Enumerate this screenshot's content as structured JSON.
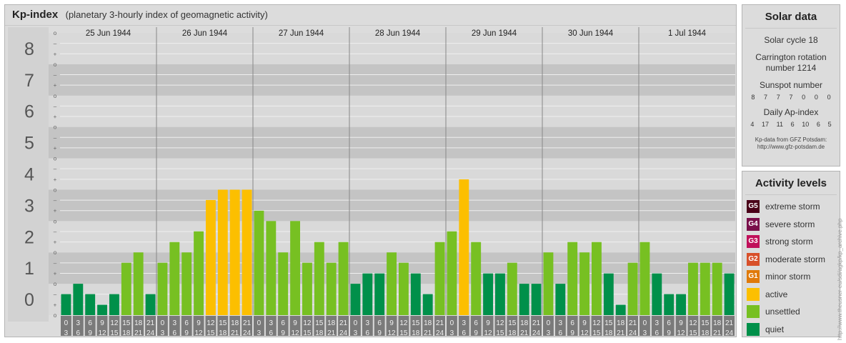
{
  "title": "Kp-index",
  "subtitle": "(planetary 3-hourly index of geomagnetic activity)",
  "chart_data": {
    "type": "bar",
    "ylim": [
      0,
      9
    ],
    "y_ticks": [
      "0",
      "1",
      "2",
      "3",
      "4",
      "5",
      "6",
      "7",
      "8",
      "9"
    ],
    "minor_tick_labels": [
      "o",
      "+",
      "–"
    ],
    "days": [
      "25 Jun 1944",
      "26 Jun 1944",
      "27 Jun 1944",
      "28 Jun 1944",
      "29 Jun 1944",
      "30 Jun 1944",
      "1 Jul 1944"
    ],
    "interval_top": [
      "0",
      "3",
      "6",
      "9",
      "12",
      "15",
      "18",
      "21"
    ],
    "interval_bottom": [
      "3",
      "6",
      "9",
      "12",
      "15",
      "18",
      "21",
      "24"
    ],
    "values": [
      [
        0.67,
        1.0,
        0.67,
        0.33,
        0.67,
        1.67,
        2.0,
        0.67
      ],
      [
        1.67,
        2.33,
        2.0,
        2.67,
        3.67,
        4.0,
        4.0,
        4.0
      ],
      [
        3.33,
        3.0,
        2.0,
        3.0,
        1.67,
        2.33,
        1.67,
        2.33
      ],
      [
        1.0,
        1.33,
        1.33,
        2.0,
        1.67,
        1.33,
        0.67,
        2.33
      ],
      [
        2.67,
        4.33,
        2.33,
        1.33,
        1.33,
        1.67,
        1.0,
        1.0
      ],
      [
        2.0,
        1.0,
        2.33,
        2.0,
        2.33,
        1.33,
        0.33,
        1.67
      ],
      [
        2.33,
        1.33,
        0.67,
        0.67,
        1.67,
        1.67,
        1.67,
        1.33
      ]
    ],
    "colors": {
      "quiet": "#00904a",
      "unsettled": "#77c022",
      "active": "#fcbf00",
      "minor": "#e07a0a",
      "moderate": "#d8502a",
      "strong": "#c0105a",
      "severe": "#7a0f4a",
      "extreme": "#4a0018"
    }
  },
  "solar": {
    "heading": "Solar data",
    "cycle": "Solar cycle 18",
    "carrington": "Carrington rotation number 1214",
    "sunspot_label": "Sunspot number",
    "sunspots": [
      "8",
      "7",
      "7",
      "7",
      "0",
      "0",
      "0"
    ],
    "ap_label": "Daily Ap-index",
    "ap": [
      "4",
      "17",
      "11",
      "6",
      "10",
      "6",
      "5"
    ],
    "source_line1": "Kp-data from GFZ Potsdam:",
    "source_line2": "http://www.gfz-potsdam.de"
  },
  "legend": {
    "heading": "Activity levels",
    "items": [
      {
        "code": "G5",
        "label": "extreme storm",
        "color": "#4a0018"
      },
      {
        "code": "G4",
        "label": "severe storm",
        "color": "#7a0f4a"
      },
      {
        "code": "G3",
        "label": "strong storm",
        "color": "#c0105a"
      },
      {
        "code": "G2",
        "label": "moderate storm",
        "color": "#d8502a"
      },
      {
        "code": "G1",
        "label": "minor storm",
        "color": "#e07a0a"
      },
      {
        "code": "",
        "label": "active",
        "color": "#fcbf00"
      },
      {
        "code": "",
        "label": "unsettled",
        "color": "#77c022"
      },
      {
        "code": "",
        "label": "quiet",
        "color": "#00904a"
      }
    ]
  },
  "watermark": "http://www.theusner-eu/sdi/agkp/kp_archive.php"
}
